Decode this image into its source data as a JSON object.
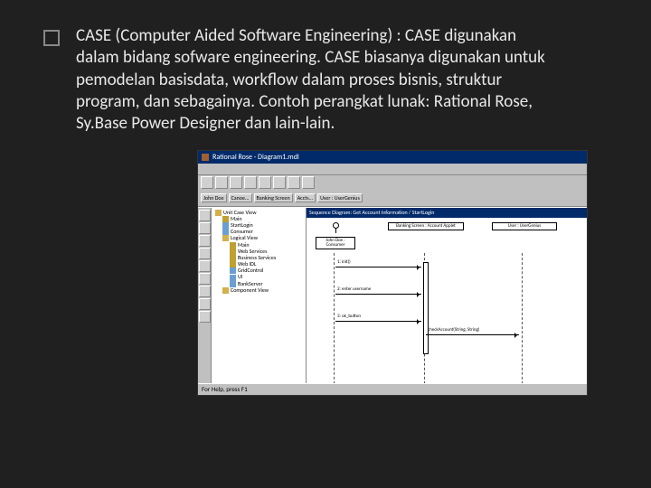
{
  "bullet_text": "CASE (Computer Aided Software Engineering) : CASE digunakan dalam bidang sofware engineering. CASE biasanya digunakan untuk pemodelan basisdata, workflow dalam proses bisnis, struktur program, dan sebagainya. Contoh perangkat lunak: Rational Rose, Sy.Base Power Designer dan lain-lain.",
  "app": {
    "title": "Rational Rose - Diagram1.mdl",
    "diagram_title": "Sequence Diagram: Get Account Information / StartLogin",
    "status": "For Help, press F1",
    "tabs": [
      "John Doe",
      "Canoe...",
      "Banking Screen",
      "Accts...",
      "User : UserGenius"
    ],
    "actor": {
      "name": "John Doe",
      "role": "Consumer"
    },
    "objects": [
      {
        "label": "Banking Screen : Account Applet"
      },
      {
        "label": "User : UserGenius"
      }
    ],
    "messages": [
      "1: init()",
      "2: enter username",
      "3: ok_button",
      "checkAccount(String, String)"
    ],
    "tree": {
      "root": "Unit Case View",
      "items": [
        {
          "l": 1,
          "ic": "pkg",
          "label": "Main"
        },
        {
          "l": 1,
          "ic": "cls",
          "label": "StartLogin"
        },
        {
          "l": 1,
          "ic": "cls",
          "label": "Consumer"
        },
        {
          "l": 1,
          "ic": "folder",
          "label": "Logical View"
        },
        {
          "l": 2,
          "ic": "pkg",
          "label": "Main"
        },
        {
          "l": 2,
          "ic": "pkg",
          "label": "Web Services"
        },
        {
          "l": 2,
          "ic": "pkg",
          "label": "Business Services"
        },
        {
          "l": 2,
          "ic": "pkg",
          "label": "Web IDL"
        },
        {
          "l": 2,
          "ic": "cls",
          "label": "GridControl"
        },
        {
          "l": 2,
          "ic": "cls",
          "label": "UI"
        },
        {
          "l": 2,
          "ic": "cls",
          "label": "BankServer"
        },
        {
          "l": 1,
          "ic": "folder",
          "label": "Component View"
        }
      ]
    }
  }
}
